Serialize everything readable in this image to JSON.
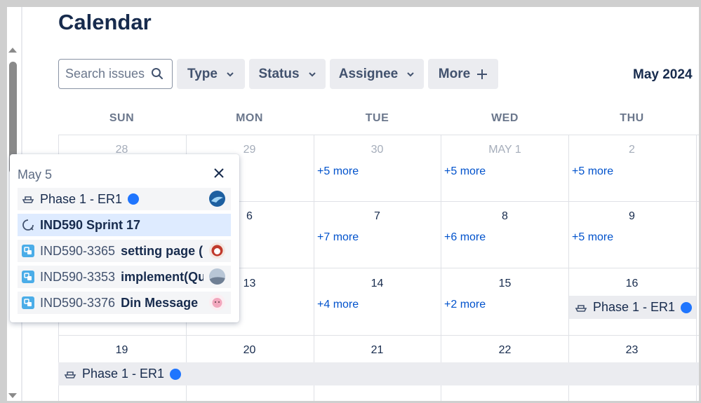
{
  "title": "Calendar",
  "search": {
    "placeholder": "Search issues"
  },
  "filters": {
    "type": "Type",
    "status": "Status",
    "assignee": "Assignee",
    "more": "More"
  },
  "month": "May 2024",
  "weekdays": [
    "SUN",
    "MON",
    "TUE",
    "WED",
    "THU"
  ],
  "weeks": [
    {
      "days": [
        "28",
        "29",
        "30",
        "MAY 1",
        "2"
      ],
      "more": [
        "",
        "",
        "+5 more",
        "+5 more",
        "+5 more"
      ]
    },
    {
      "days": [
        "",
        "6",
        "7",
        "8",
        "9"
      ],
      "more": [
        "",
        "",
        "+7 more",
        "+6 more",
        "+5 more"
      ]
    },
    {
      "days": [
        "",
        "13",
        "14",
        "15",
        "16"
      ],
      "more": [
        "",
        "",
        "+4 more",
        "+2 more",
        ""
      ],
      "event": "Phase 1 - ER1"
    },
    {
      "days": [
        "19",
        "20",
        "21",
        "22",
        "23"
      ],
      "event": "Phase 1 - ER1"
    }
  ],
  "popup": {
    "date": "May 5",
    "items": [
      {
        "kind": "release",
        "label": "Phase 1 - ER1",
        "avatar": "dolphin"
      },
      {
        "kind": "sprint",
        "label": "IND590 Sprint 17"
      },
      {
        "kind": "subtask",
        "key": "IND590-3365",
        "summary": "setting page (",
        "avatar": "red-character"
      },
      {
        "kind": "subtask",
        "key": "IND590-3353",
        "summary": "implement(Qu",
        "avatar": "landscape"
      },
      {
        "kind": "subtask",
        "key": "IND590-3376",
        "summary": "Din Message",
        "avatar": "pink-character"
      }
    ]
  },
  "colors": {
    "accent": "#0052cc",
    "release_dot": "#1f75fe",
    "subtask_icon": "#4bade8",
    "sprint_highlight": "#deebff"
  }
}
